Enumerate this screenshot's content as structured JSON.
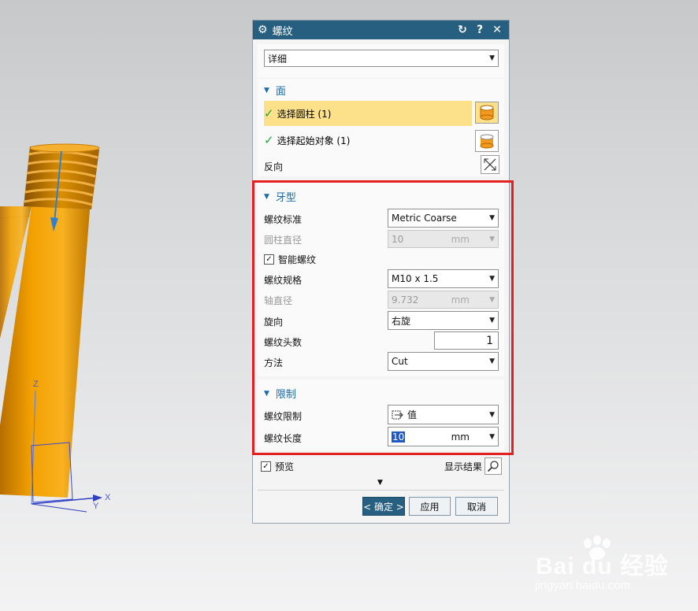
{
  "dialog": {
    "title": "螺纹",
    "reset_icon": "reset-icon",
    "help_label": "?",
    "close_label": "✕",
    "mode": "详细"
  },
  "face_section": {
    "heading": "面",
    "select_cylinder": "选择圆柱 (1)",
    "select_start": "选择起始对象 (1)",
    "reverse": "反向"
  },
  "thread_section": {
    "heading": "牙型",
    "standard_label": "螺纹标准",
    "standard_value": "Metric Coarse",
    "cylinder_dia_label": "圆柱直径",
    "cylinder_dia_value": "10",
    "cylinder_dia_unit": "mm",
    "smart_thread_label": "智能螺纹",
    "smart_thread_checked": "✓",
    "spec_label": "螺纹规格",
    "spec_value": "M10 x 1.5",
    "shaft_dia_label": "轴直径",
    "shaft_dia_value": "9.732",
    "shaft_dia_unit": "mm",
    "hand_label": "旋向",
    "hand_value": "右旋",
    "starts_label": "螺纹头数",
    "starts_value": "1",
    "method_label": "方法",
    "method_value": "Cut"
  },
  "limit_section": {
    "heading": "限制",
    "limit_label": "螺纹限制",
    "limit_value": "值",
    "length_label": "螺纹长度",
    "length_value": "10",
    "length_unit": "mm"
  },
  "footer": {
    "preview_label": "预览",
    "preview_checked": "✓",
    "show_result_label": "显示结果",
    "ok_label": "< 确定 >",
    "apply_label": "应用",
    "cancel_label": "取消"
  },
  "viewport": {
    "axis_z": "Z",
    "axis_x": "X",
    "axis_y": "Y"
  },
  "watermark": {
    "brand": "Bai du 经验",
    "url": "jingyan.baidu.com"
  },
  "colors": {
    "titlebar": "#265f80",
    "part": "#f0a000",
    "highlight_row": "#fde08a",
    "annotation": "#e31f1f"
  }
}
